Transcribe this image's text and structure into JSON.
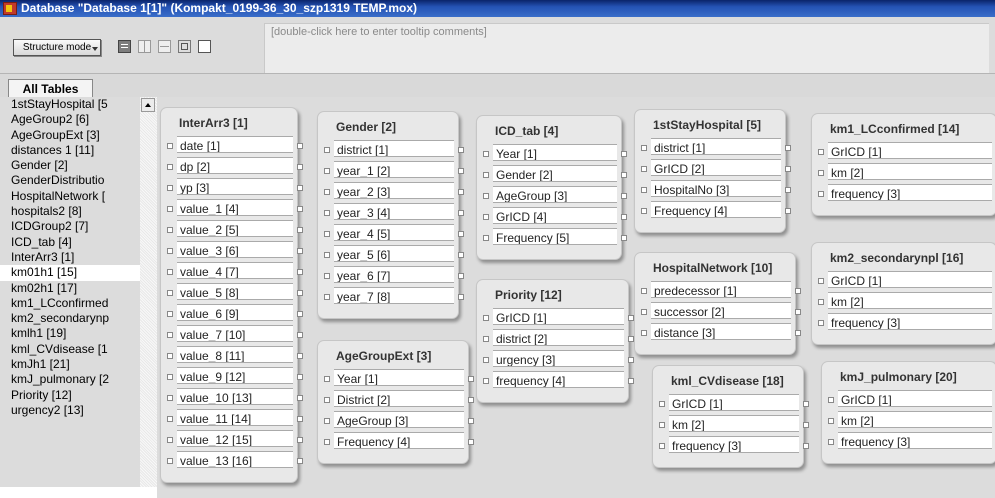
{
  "window": {
    "title": "Database \"Database 1[1]\" (Kompakt_0199-36_30_szp1319 TEMP.mox)"
  },
  "toolbar": {
    "structure_mode_label": "Structure mode",
    "tooltip_placeholder": "[double-click here to enter tooltip comments]"
  },
  "tabs": [
    {
      "label": "All Tables"
    }
  ],
  "table_list": [
    "1stStayHospital [5",
    "AgeGroup2 [6]",
    "AgeGroupExt [3]",
    "distances 1 [11]",
    "Gender [2]",
    "GenderDistributio",
    "HospitalNetwork [",
    "hospitals2 [8]",
    "ICDGroup2 [7]",
    "ICD_tab [4]",
    "InterArr3 [1]",
    "km01h1 [15]",
    "km02h1 [17]",
    "km1_LCconfirmed",
    "km2_secondarynp",
    "kmlh1 [19]",
    "kml_CVdisease [1",
    "kmJh1 [21]",
    "kmJ_pulmonary [2",
    "Priority [12]",
    "urgency2 [13]"
  ],
  "selected_index": 11,
  "tables": [
    {
      "name": "InterArr3 [1]",
      "fields": [
        "date [1]",
        "dp [2]",
        "yp [3]",
        "value_1 [4]",
        "value_2 [5]",
        "value_3 [6]",
        "value_4 [7]",
        "value_5 [8]",
        "value_6 [9]",
        "value_7 [10]",
        "value_8 [11]",
        "value_9 [12]",
        "value_10 [13]",
        "value_11 [14]",
        "value_12 [15]",
        "value_13 [16]"
      ]
    },
    {
      "name": "Gender [2]",
      "fields": [
        "district [1]",
        "year_1 [2]",
        "year_2 [3]",
        "year_3 [4]",
        "year_4 [5]",
        "year_5 [6]",
        "year_6 [7]",
        "year_7 [8]"
      ]
    },
    {
      "name": "AgeGroupExt [3]",
      "fields": [
        "Year [1]",
        "District [2]",
        "AgeGroup [3]",
        "Frequency [4]"
      ]
    },
    {
      "name": "ICD_tab [4]",
      "fields": [
        "Year [1]",
        "Gender [2]",
        "AgeGroup [3]",
        "GrICD [4]",
        "Frequency [5]"
      ]
    },
    {
      "name": "Priority [12]",
      "fields": [
        "GrICD [1]",
        "district [2]",
        "urgency [3]",
        "frequency [4]"
      ]
    },
    {
      "name": "1stStayHospital [5]",
      "fields": [
        "district [1]",
        "GrICD [2]",
        "HospitalNo [3]",
        "Frequency [4]"
      ]
    },
    {
      "name": "HospitalNetwork [10]",
      "fields": [
        "predecessor [1]",
        "successor [2]",
        "distance [3]"
      ]
    },
    {
      "name": "kml_CVdisease [18]",
      "fields": [
        "GrICD [1]",
        "km [2]",
        "frequency [3]"
      ]
    },
    {
      "name": "km1_LCconfirmed [14]",
      "fields": [
        "GrICD [1]",
        "km [2]",
        "frequency [3]"
      ]
    },
    {
      "name": "km2_secondarynpl [16]",
      "fields": [
        "GrICD [1]",
        "km [2]",
        "frequency [3]"
      ]
    },
    {
      "name": "kmJ_pulmonary [20]",
      "fields": [
        "GrICD [1]",
        "km [2]",
        "frequency [3]"
      ]
    }
  ]
}
